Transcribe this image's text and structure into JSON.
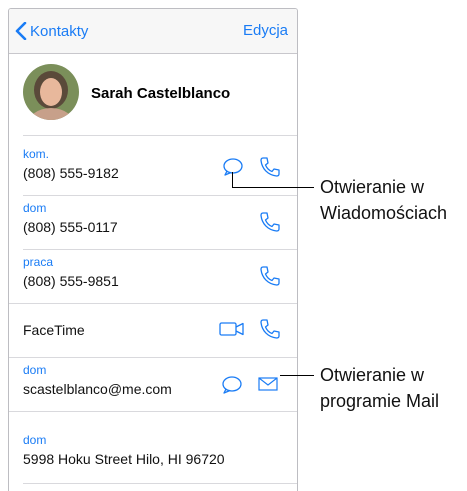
{
  "navbar": {
    "back_label": "Kontakty",
    "edit_label": "Edycja"
  },
  "contact": {
    "name": "Sarah Castelblanco"
  },
  "rows": {
    "mobile": {
      "label": "kom.",
      "value": "(808) 555-9182"
    },
    "home_phone": {
      "label": "dom",
      "value": "(808) 555-0117"
    },
    "work_phone": {
      "label": "praca",
      "value": "(808) 555-9851"
    },
    "facetime": {
      "value": "FaceTime"
    },
    "email": {
      "label": "dom",
      "value": "scastelblanco@me.com"
    },
    "address": {
      "label": "dom",
      "value": "5998 Hoku Street Hilo, HI 96720"
    }
  },
  "callouts": {
    "messages": {
      "line1": "Otwieranie w",
      "line2": "Wiadomościach"
    },
    "mail": {
      "line1": "Otwieranie w",
      "line2": "programie Mail"
    }
  },
  "colors": {
    "accent": "#1a7cf5",
    "separator": "#d9d9dd",
    "navbar_bg": "#f7f7f7"
  },
  "icons": {
    "back": "chevron-left-icon",
    "message": "speech-bubble-icon",
    "phone": "phone-handset-icon",
    "video": "video-camera-icon",
    "mail": "envelope-icon"
  }
}
